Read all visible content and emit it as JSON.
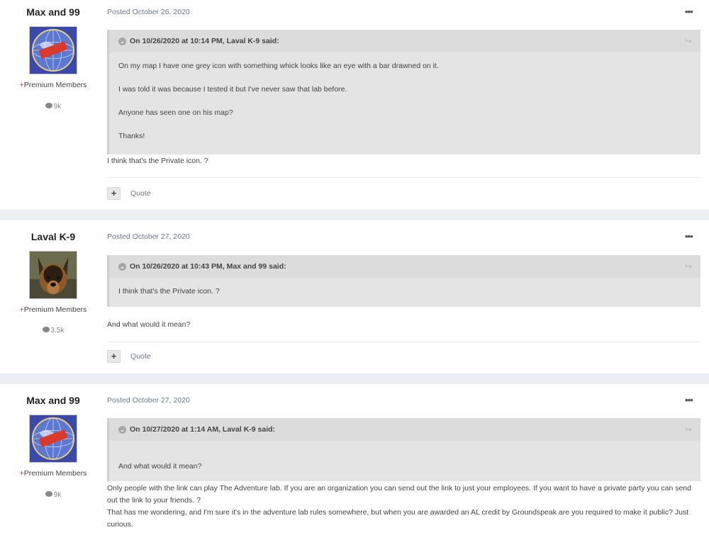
{
  "posts": [
    {
      "author": "Max and 99",
      "group_plus": "+",
      "group": "Premium Members",
      "post_count": "9k",
      "posted": "Posted October 26, 2020",
      "menu": "•••",
      "quote_header": "On 10/26/2020 at 10:14 PM, Laval K-9 said:",
      "quote_lines": [
        "On my map I have one grey icon with something whick looks like an eye with a bar drawned on it.",
        "I was told it was because I tested it but I've never saw that lab before.",
        "Anyone has seen one on his map?",
        "Thanks!"
      ],
      "reply": "I think that's the Private icon. ?",
      "plus": "+",
      "quote_button": "Quote"
    },
    {
      "author": "Laval K-9",
      "group_plus": "+",
      "group": "Premium Members",
      "post_count": "3.5k",
      "posted": "Posted October 27, 2020",
      "menu": "•••",
      "quote_header": "On 10/26/2020 at 10:43 PM, Max and 99 said:",
      "quote_lines": [
        "I think that's the Private icon. ?"
      ],
      "reply": "And what would it mean?",
      "plus": "+",
      "quote_button": "Quote"
    },
    {
      "author": "Max and 99",
      "group_plus": "+",
      "group": "Premium Members",
      "post_count": "9k",
      "posted": "Posted October 27, 2020",
      "menu": "•••",
      "quote_header": "On 10/27/2020 at 1:14 AM, Laval K-9 said:",
      "quote_lines": [
        "And what would it mean?"
      ],
      "reply_lines": [
        "Only people with the link can play The Adventure lab. If you are an organization you can send out the link to just your employees. If you want to have a private party you can send out the link to your friends. ?",
        "That has me wondering, and I'm sure it's in the adventure lab rules somewhere, but when you are awarded an AL credit by Groundspeak are you required to make it public? Just curious."
      ]
    }
  ],
  "icons": {
    "chevron": "⌄",
    "share": "↪",
    "comment": "comment-icon"
  }
}
